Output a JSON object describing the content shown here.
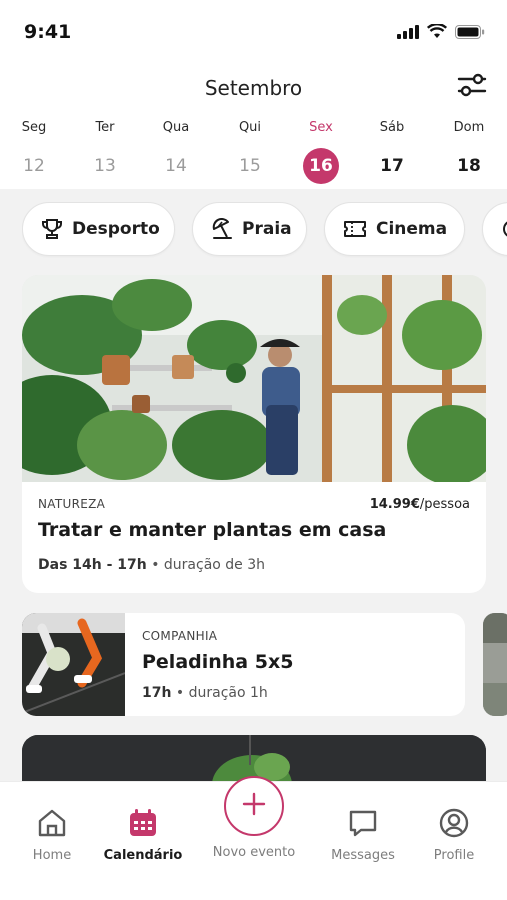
{
  "status": {
    "time": "9:41"
  },
  "header": {
    "month": "Setembro",
    "filter_icon": "sliders-icon"
  },
  "days": [
    {
      "name": "Seg",
      "num": "12",
      "state": "past"
    },
    {
      "name": "Ter",
      "num": "13",
      "state": "past"
    },
    {
      "name": "Qua",
      "num": "14",
      "state": "past"
    },
    {
      "name": "Qui",
      "num": "15",
      "state": "past"
    },
    {
      "name": "Sex",
      "num": "16",
      "state": "selected"
    },
    {
      "name": "Sáb",
      "num": "17",
      "state": "future"
    },
    {
      "name": "Dom",
      "num": "18",
      "state": "future"
    }
  ],
  "categories": [
    {
      "label": "Desporto",
      "icon": "trophy-icon"
    },
    {
      "label": "Praia",
      "icon": "beach-umbrella-icon"
    },
    {
      "label": "Cinema",
      "icon": "ticket-icon"
    }
  ],
  "events": {
    "featured": {
      "category": "NATUREZA",
      "price": "14.99€",
      "price_unit": "/pessoa",
      "title": "Tratar e manter plantas em casa",
      "time": "Das 14h - 17h",
      "separator": "•",
      "duration": "duração de 3h"
    },
    "second": {
      "category": "COMPANHIA",
      "title": "Peladinha 5x5",
      "time": "17h",
      "separator": "•",
      "duration": "duração 1h"
    }
  },
  "tabs": {
    "home": "Home",
    "calendar": "Calendário",
    "new_event": "Novo evento",
    "messages": "Messages",
    "profile": "Profile"
  },
  "colors": {
    "accent": "#c4386b",
    "background": "#f2f2f2"
  }
}
